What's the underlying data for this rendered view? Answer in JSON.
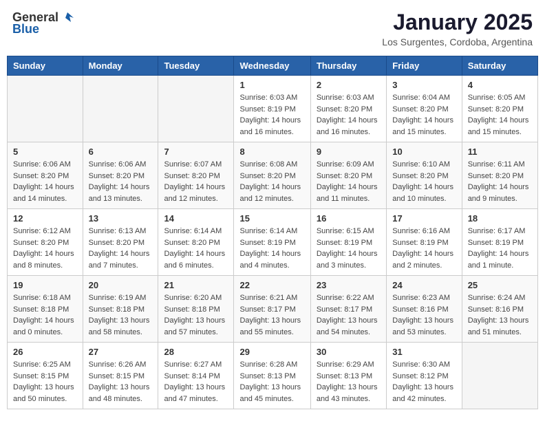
{
  "header": {
    "logo_line1": "General",
    "logo_line2": "Blue",
    "month_title": "January 2025",
    "location": "Los Surgentes, Cordoba, Argentina"
  },
  "weekdays": [
    "Sunday",
    "Monday",
    "Tuesday",
    "Wednesday",
    "Thursday",
    "Friday",
    "Saturday"
  ],
  "weeks": [
    [
      {
        "day": "",
        "info": ""
      },
      {
        "day": "",
        "info": ""
      },
      {
        "day": "",
        "info": ""
      },
      {
        "day": "1",
        "info": "Sunrise: 6:03 AM\nSunset: 8:19 PM\nDaylight: 14 hours\nand 16 minutes."
      },
      {
        "day": "2",
        "info": "Sunrise: 6:03 AM\nSunset: 8:20 PM\nDaylight: 14 hours\nand 16 minutes."
      },
      {
        "day": "3",
        "info": "Sunrise: 6:04 AM\nSunset: 8:20 PM\nDaylight: 14 hours\nand 15 minutes."
      },
      {
        "day": "4",
        "info": "Sunrise: 6:05 AM\nSunset: 8:20 PM\nDaylight: 14 hours\nand 15 minutes."
      }
    ],
    [
      {
        "day": "5",
        "info": "Sunrise: 6:06 AM\nSunset: 8:20 PM\nDaylight: 14 hours\nand 14 minutes."
      },
      {
        "day": "6",
        "info": "Sunrise: 6:06 AM\nSunset: 8:20 PM\nDaylight: 14 hours\nand 13 minutes."
      },
      {
        "day": "7",
        "info": "Sunrise: 6:07 AM\nSunset: 8:20 PM\nDaylight: 14 hours\nand 12 minutes."
      },
      {
        "day": "8",
        "info": "Sunrise: 6:08 AM\nSunset: 8:20 PM\nDaylight: 14 hours\nand 12 minutes."
      },
      {
        "day": "9",
        "info": "Sunrise: 6:09 AM\nSunset: 8:20 PM\nDaylight: 14 hours\nand 11 minutes."
      },
      {
        "day": "10",
        "info": "Sunrise: 6:10 AM\nSunset: 8:20 PM\nDaylight: 14 hours\nand 10 minutes."
      },
      {
        "day": "11",
        "info": "Sunrise: 6:11 AM\nSunset: 8:20 PM\nDaylight: 14 hours\nand 9 minutes."
      }
    ],
    [
      {
        "day": "12",
        "info": "Sunrise: 6:12 AM\nSunset: 8:20 PM\nDaylight: 14 hours\nand 8 minutes."
      },
      {
        "day": "13",
        "info": "Sunrise: 6:13 AM\nSunset: 8:20 PM\nDaylight: 14 hours\nand 7 minutes."
      },
      {
        "day": "14",
        "info": "Sunrise: 6:14 AM\nSunset: 8:20 PM\nDaylight: 14 hours\nand 6 minutes."
      },
      {
        "day": "15",
        "info": "Sunrise: 6:14 AM\nSunset: 8:19 PM\nDaylight: 14 hours\nand 4 minutes."
      },
      {
        "day": "16",
        "info": "Sunrise: 6:15 AM\nSunset: 8:19 PM\nDaylight: 14 hours\nand 3 minutes."
      },
      {
        "day": "17",
        "info": "Sunrise: 6:16 AM\nSunset: 8:19 PM\nDaylight: 14 hours\nand 2 minutes."
      },
      {
        "day": "18",
        "info": "Sunrise: 6:17 AM\nSunset: 8:19 PM\nDaylight: 14 hours\nand 1 minute."
      }
    ],
    [
      {
        "day": "19",
        "info": "Sunrise: 6:18 AM\nSunset: 8:18 PM\nDaylight: 14 hours\nand 0 minutes."
      },
      {
        "day": "20",
        "info": "Sunrise: 6:19 AM\nSunset: 8:18 PM\nDaylight: 13 hours\nand 58 minutes."
      },
      {
        "day": "21",
        "info": "Sunrise: 6:20 AM\nSunset: 8:18 PM\nDaylight: 13 hours\nand 57 minutes."
      },
      {
        "day": "22",
        "info": "Sunrise: 6:21 AM\nSunset: 8:17 PM\nDaylight: 13 hours\nand 55 minutes."
      },
      {
        "day": "23",
        "info": "Sunrise: 6:22 AM\nSunset: 8:17 PM\nDaylight: 13 hours\nand 54 minutes."
      },
      {
        "day": "24",
        "info": "Sunrise: 6:23 AM\nSunset: 8:16 PM\nDaylight: 13 hours\nand 53 minutes."
      },
      {
        "day": "25",
        "info": "Sunrise: 6:24 AM\nSunset: 8:16 PM\nDaylight: 13 hours\nand 51 minutes."
      }
    ],
    [
      {
        "day": "26",
        "info": "Sunrise: 6:25 AM\nSunset: 8:15 PM\nDaylight: 13 hours\nand 50 minutes."
      },
      {
        "day": "27",
        "info": "Sunrise: 6:26 AM\nSunset: 8:15 PM\nDaylight: 13 hours\nand 48 minutes."
      },
      {
        "day": "28",
        "info": "Sunrise: 6:27 AM\nSunset: 8:14 PM\nDaylight: 13 hours\nand 47 minutes."
      },
      {
        "day": "29",
        "info": "Sunrise: 6:28 AM\nSunset: 8:13 PM\nDaylight: 13 hours\nand 45 minutes."
      },
      {
        "day": "30",
        "info": "Sunrise: 6:29 AM\nSunset: 8:13 PM\nDaylight: 13 hours\nand 43 minutes."
      },
      {
        "day": "31",
        "info": "Sunrise: 6:30 AM\nSunset: 8:12 PM\nDaylight: 13 hours\nand 42 minutes."
      },
      {
        "day": "",
        "info": ""
      }
    ]
  ]
}
